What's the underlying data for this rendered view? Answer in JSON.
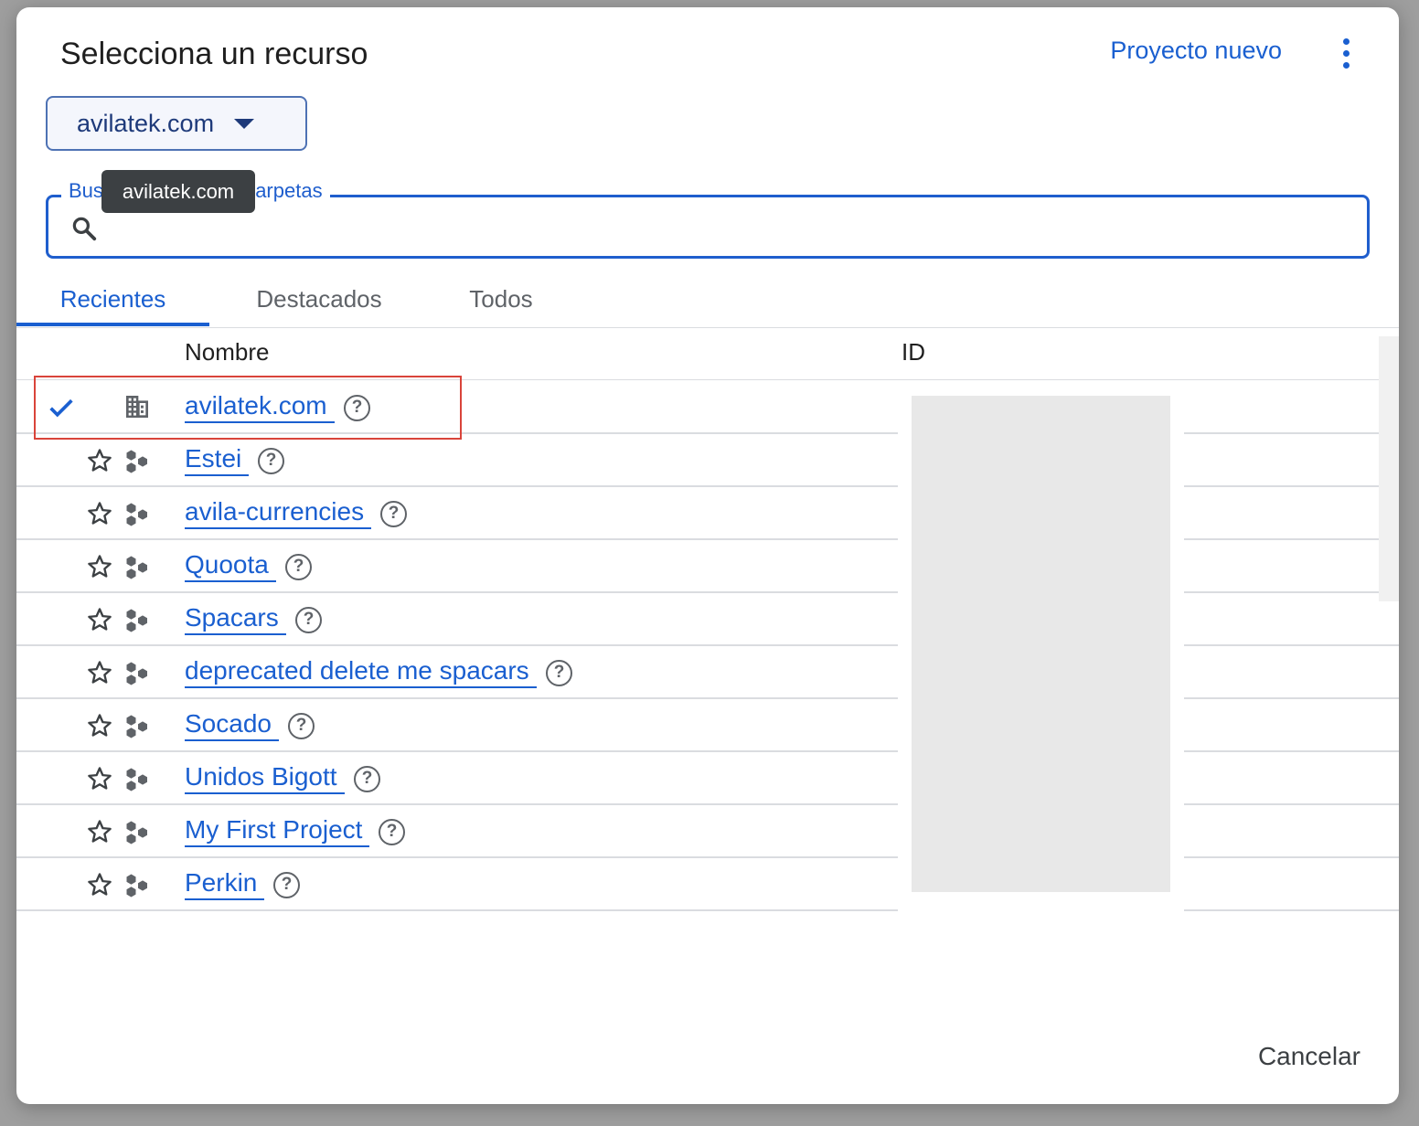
{
  "dialog": {
    "title": "Selecciona un recurso",
    "new_project_label": "Proyecto nuevo",
    "more_icon": "more-vert-icon"
  },
  "org_selector": {
    "value": "avilatek.com"
  },
  "search": {
    "label": "Buscar proyectos y carpetas",
    "value": ""
  },
  "tooltip": {
    "text": "avilatek.com"
  },
  "tabs": [
    {
      "label": "Recientes",
      "active": true
    },
    {
      "label": "Destacados",
      "active": false
    },
    {
      "label": "Todos",
      "active": false
    }
  ],
  "table": {
    "headers": {
      "name": "Nombre",
      "id": "ID"
    },
    "rows": [
      {
        "name": "avilatek.com",
        "type": "organization",
        "selected": true
      },
      {
        "name": "Estei",
        "type": "project"
      },
      {
        "name": "avila-currencies",
        "type": "project"
      },
      {
        "name": "Quoota",
        "type": "project"
      },
      {
        "name": "Spacars",
        "type": "project"
      },
      {
        "name": "deprecated delete me spacars",
        "type": "project"
      },
      {
        "name": "Socado",
        "type": "project"
      },
      {
        "name": "Unidos Bigott",
        "type": "project"
      },
      {
        "name": "My First Project",
        "type": "project"
      },
      {
        "name": "Perkin",
        "type": "project"
      }
    ]
  },
  "footer": {
    "cancel_label": "Cancelar"
  },
  "colors": {
    "accent": "#1a5fd0",
    "highlight_border": "#d9443a"
  }
}
